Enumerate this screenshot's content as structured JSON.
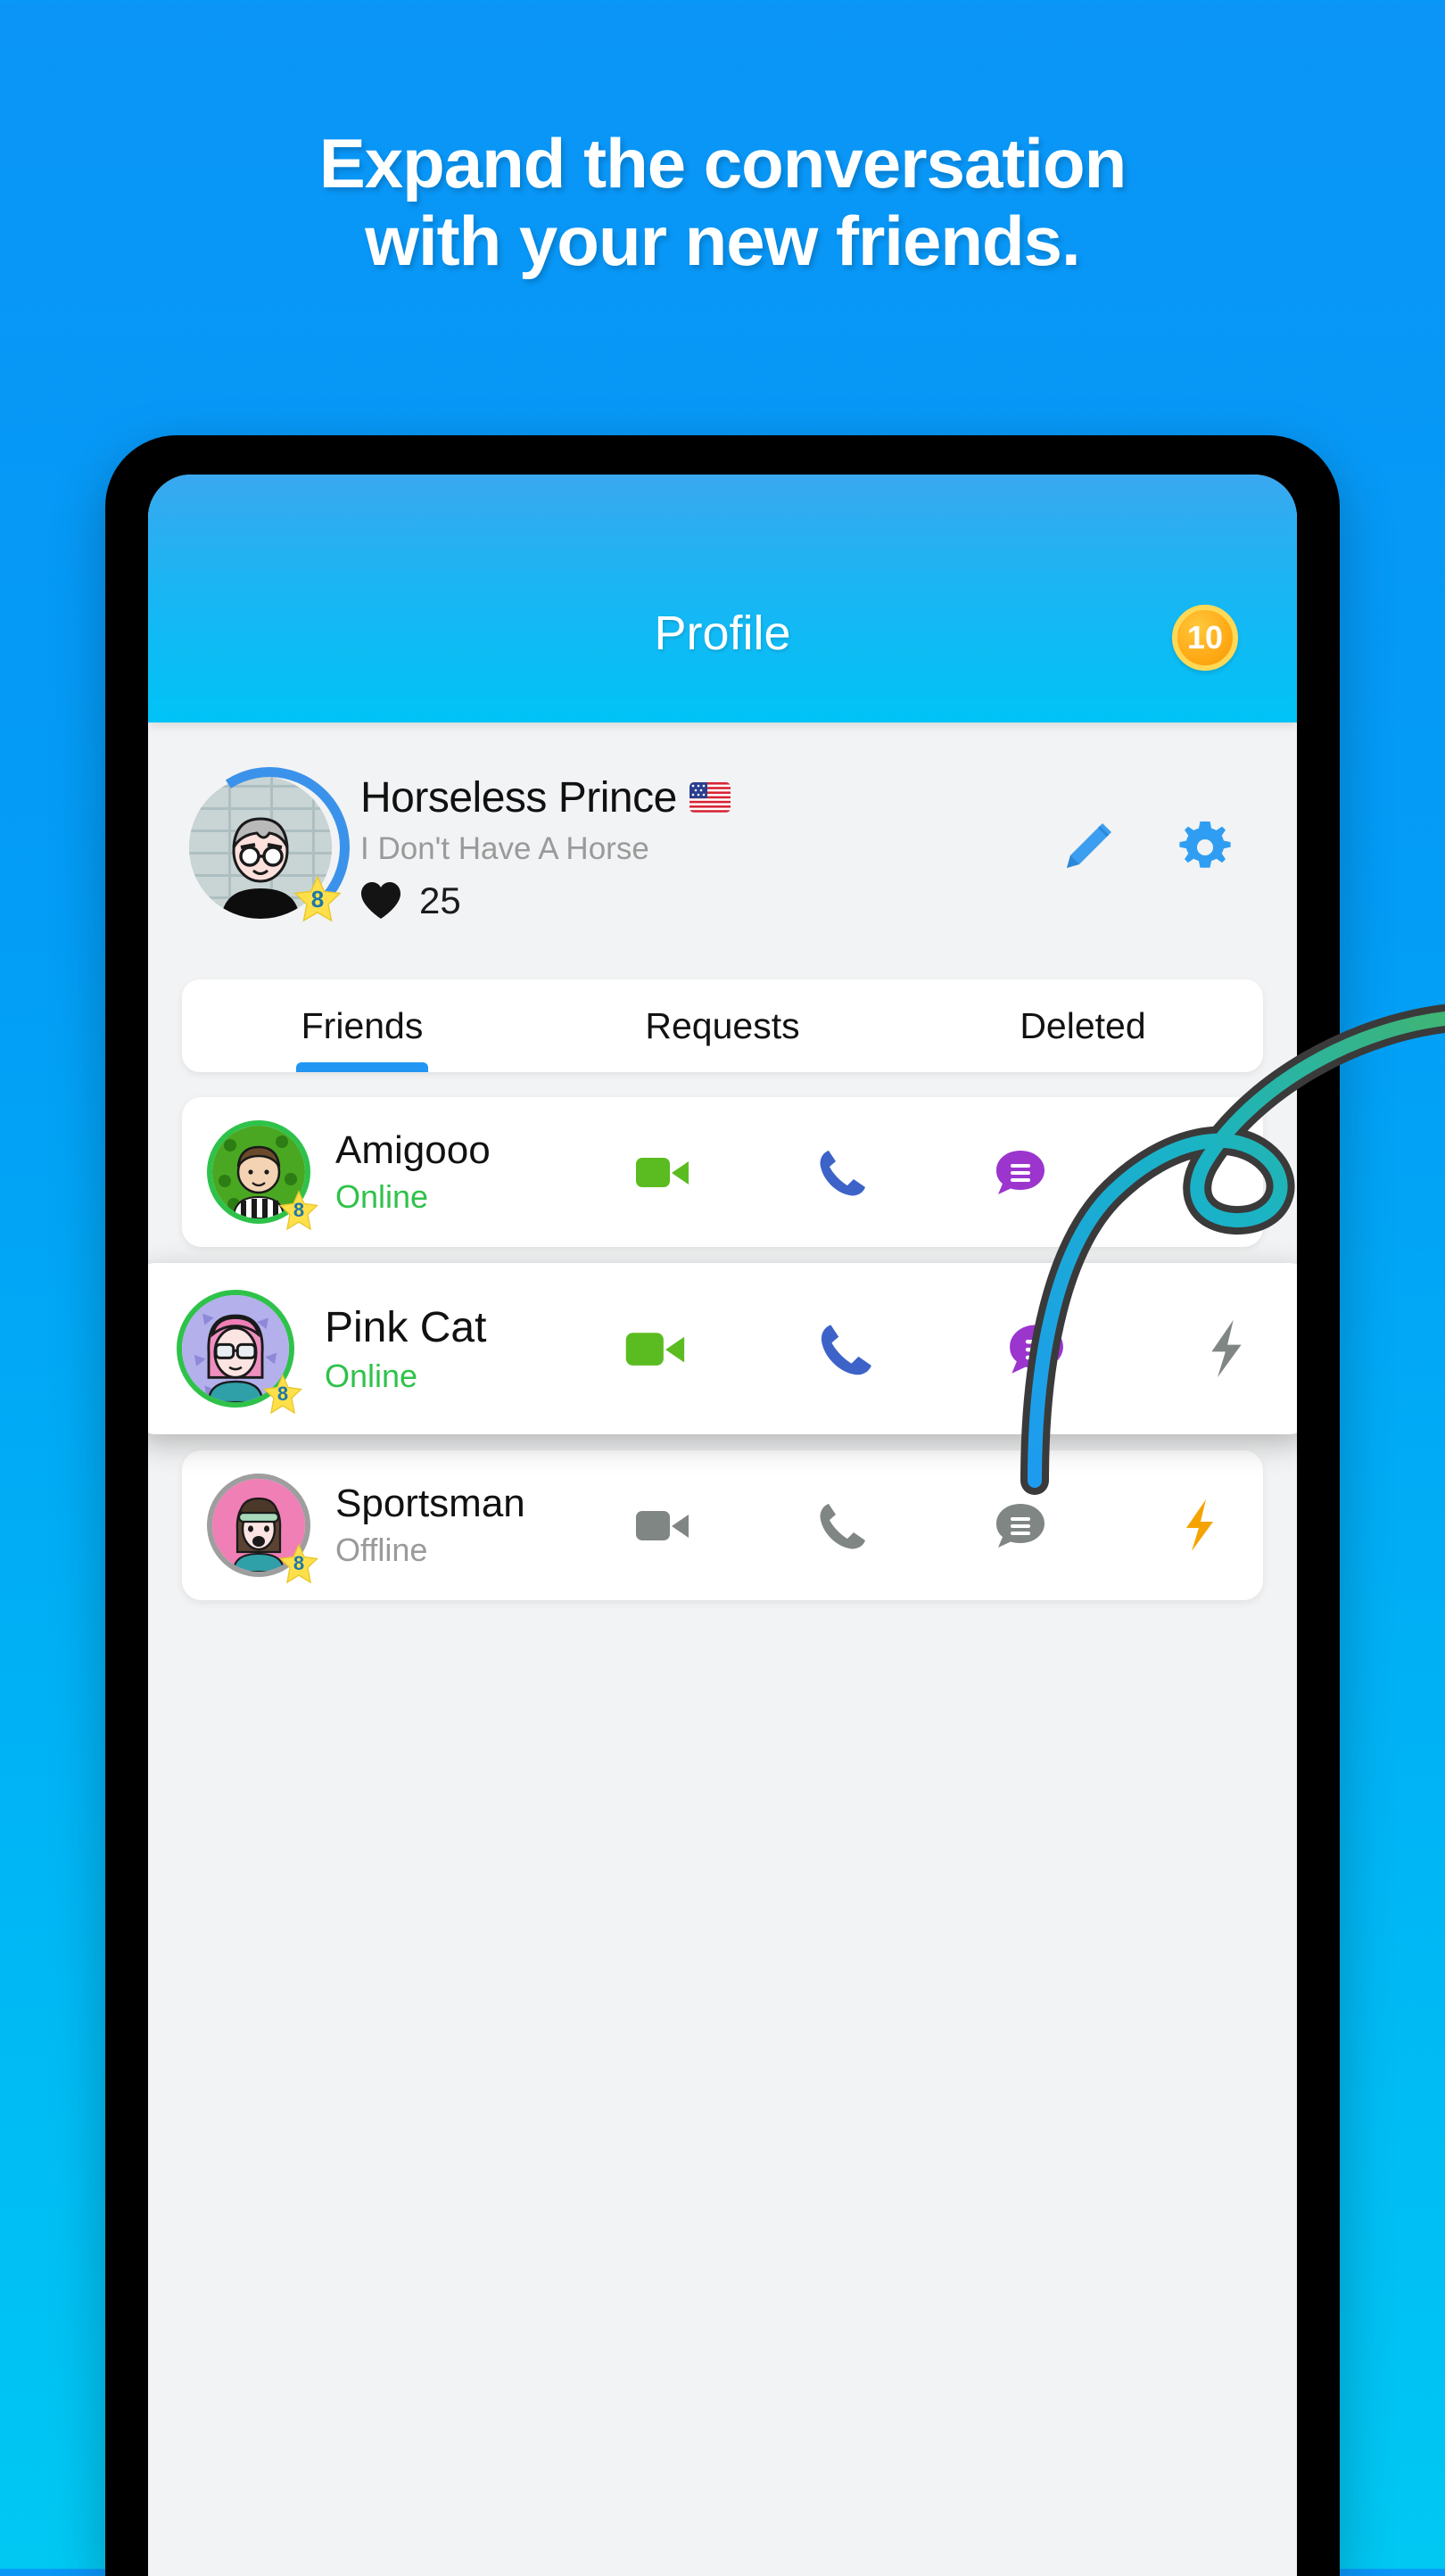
{
  "headline": {
    "line1": "Expand the conversation",
    "line2": "with your new friends."
  },
  "colors": {
    "background_top": "#0A95F7",
    "background_bottom": "#00C8F3",
    "accent_blue": "#2196F3",
    "online_green": "#2FC24A",
    "offline_gray": "#9A9A9A",
    "video_green": "#5BBC21",
    "call_blue": "#3D63C9",
    "chat_purple": "#9B35CE",
    "bolt_gray": "#808684",
    "bolt_amber": "#F5A300",
    "coin_gold": "#FFAB18",
    "star_yellow": "#FFE04A"
  },
  "appbar": {
    "title": "Profile",
    "coin_count": "10",
    "coin_icon": "coin-icon"
  },
  "profile": {
    "name": "Horseless Prince",
    "flag_icon": "us-flag-icon",
    "bio": "I Don't Have A Horse",
    "likes_icon": "heart-icon",
    "likes_count": "25",
    "level_badge": "8",
    "avatar_icon": "profile-avatar",
    "edit_icon": "pencil-icon",
    "settings_icon": "gear-icon"
  },
  "tabs": [
    {
      "label": "Friends",
      "active": true
    },
    {
      "label": "Requests",
      "active": false
    },
    {
      "label": "Deleted",
      "active": false
    }
  ],
  "friends": [
    {
      "name": "Amigooo",
      "status": "Online",
      "online": true,
      "level_badge": "8",
      "highlighted": false,
      "actions": [
        {
          "icon": "video-call-icon",
          "enabled": true
        },
        {
          "icon": "voice-call-icon",
          "enabled": true
        },
        {
          "icon": "chat-bubble-icon",
          "enabled": true
        },
        {
          "icon": "lightning-bolt-icon",
          "enabled": false
        }
      ]
    },
    {
      "name": "Pink Cat",
      "status": "Online",
      "online": true,
      "level_badge": "8",
      "highlighted": true,
      "actions": [
        {
          "icon": "video-call-icon",
          "enabled": true
        },
        {
          "icon": "voice-call-icon",
          "enabled": true
        },
        {
          "icon": "chat-bubble-icon",
          "enabled": true
        },
        {
          "icon": "lightning-bolt-icon",
          "enabled": false
        }
      ]
    },
    {
      "name": "Sportsman",
      "status": "Offline",
      "online": false,
      "level_badge": "8",
      "highlighted": false,
      "actions": [
        {
          "icon": "video-call-icon",
          "enabled": false
        },
        {
          "icon": "voice-call-icon",
          "enabled": false
        },
        {
          "icon": "chat-bubble-icon",
          "enabled": false
        },
        {
          "icon": "lightning-bolt-icon",
          "enabled": true
        }
      ]
    }
  ],
  "annotation": {
    "name": "curved-arrow-pointer",
    "points_to": "chat-bubble-icon of Pink Cat"
  }
}
